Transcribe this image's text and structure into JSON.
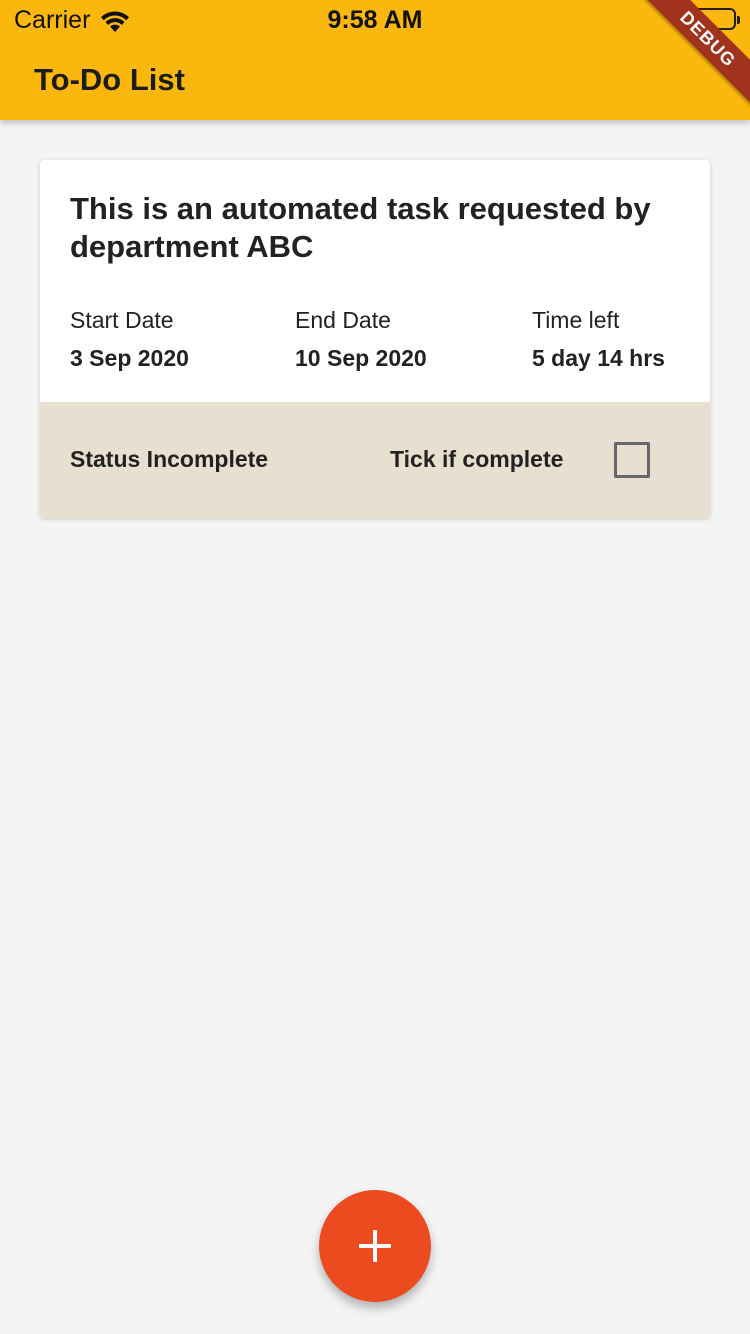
{
  "status_bar": {
    "carrier": "Carrier",
    "time": "9:58 AM",
    "wifi_icon": "wifi-icon",
    "battery_icon": "battery-icon",
    "battery_level": 0.1
  },
  "debug_banner": "DEBUG",
  "app_bar": {
    "title": "To-Do List",
    "color": "#fbb70c"
  },
  "task": {
    "title": "This is an automated task requested by department ABC",
    "start_label": "Start Date",
    "start_value": "3 Sep 2020",
    "end_label": "End Date",
    "end_value": "10 Sep 2020",
    "time_left_label": "Time left",
    "time_left_value": "5 day 14 hrs",
    "status": "Status Incomplete",
    "tick_label": "Tick if complete",
    "completed": false,
    "status_color": "#e7e0d0"
  },
  "fab": {
    "icon": "plus-icon",
    "color": "#ec4a1f"
  }
}
